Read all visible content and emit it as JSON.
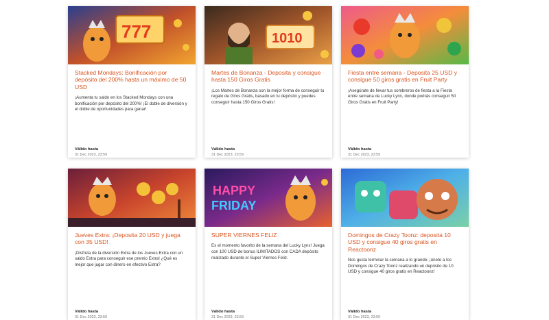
{
  "promotions": [
    {
      "title": "Stacked Mondays: Bonificación por depósito del 200% hasta un máximo de 50 USD",
      "description": "¡Aumenta tu saldo en los Stacked Mondays con una bonificación por depósito del 200%! ¡El doble de diversión y el doble de oportunidades para ganar!",
      "valid_label": "Válido hasta",
      "valid_date": "31 Dec 2023, 23:59"
    },
    {
      "title": "Martes de Bonanza - Deposita y consigue hasta 150 Giros Gratis",
      "description": "¡Los Martes de Bonanza son la mejor forma de conseguir tu regalo de Giros Gratis, basado en tu depósito y puedes conseguir hasta 150 Giros Gratis!",
      "valid_label": "Válido hasta",
      "valid_date": "31 Dec 2023, 23:59"
    },
    {
      "title": "Fiesta entre semana - Deposita 25 USD y consigue 50 giros gratis en Fruit Party",
      "description": "¡Asegúrate de llevar tus sombreros de fiesta a la Fiesta entre semana de Lucky Lynx, donde podrás conseguir 50 Giros Gratis en Fruit Party!",
      "valid_label": "Válido hasta",
      "valid_date": "31 Dec 2023, 23:59"
    },
    {
      "title": "Jueves Extra: ¡Deposita 20 USD y juega con 35 USD!",
      "description": "¡Disfruta de la diversión Extra de los Jueves Extra con un saldo Extra para conseguir ese premio Extra! ¿Qué es mejor que jugar con dinero en efectivo Extra?",
      "valid_label": "Válido hasta",
      "valid_date": "31 Dec 2023, 23:59"
    },
    {
      "title": "SUPER VIERNES FELIZ",
      "description": "Es el momento favorito de la semana del Lucky Lynx! Juega con 100 USD de bonus ILIMITADOS con CADA depósito realizado durante el Super Viernes Feliz.",
      "valid_label": "Válido hasta",
      "valid_date": "31 Dec 2023, 23:59",
      "banner_text_1": "HAPPY",
      "banner_text_2": "FRIDAY"
    },
    {
      "title": "Domingos de Crazy Toonz: deposita 10 USD y consigue 40 giros gratis en Reactoonz",
      "description": "Nos gusta terminar la semana a lo grande: ¡únete a los Domingos de Crazy Toonz realizando un depósito de 10 USD y consigue 40 giros gratis en Reactoonz!",
      "valid_label": "Válido hasta",
      "valid_date": "31 Dec 2023, 23:59"
    }
  ],
  "colors": {
    "title": "#d9531e",
    "text": "#333333",
    "card_bg": "#ffffff"
  }
}
